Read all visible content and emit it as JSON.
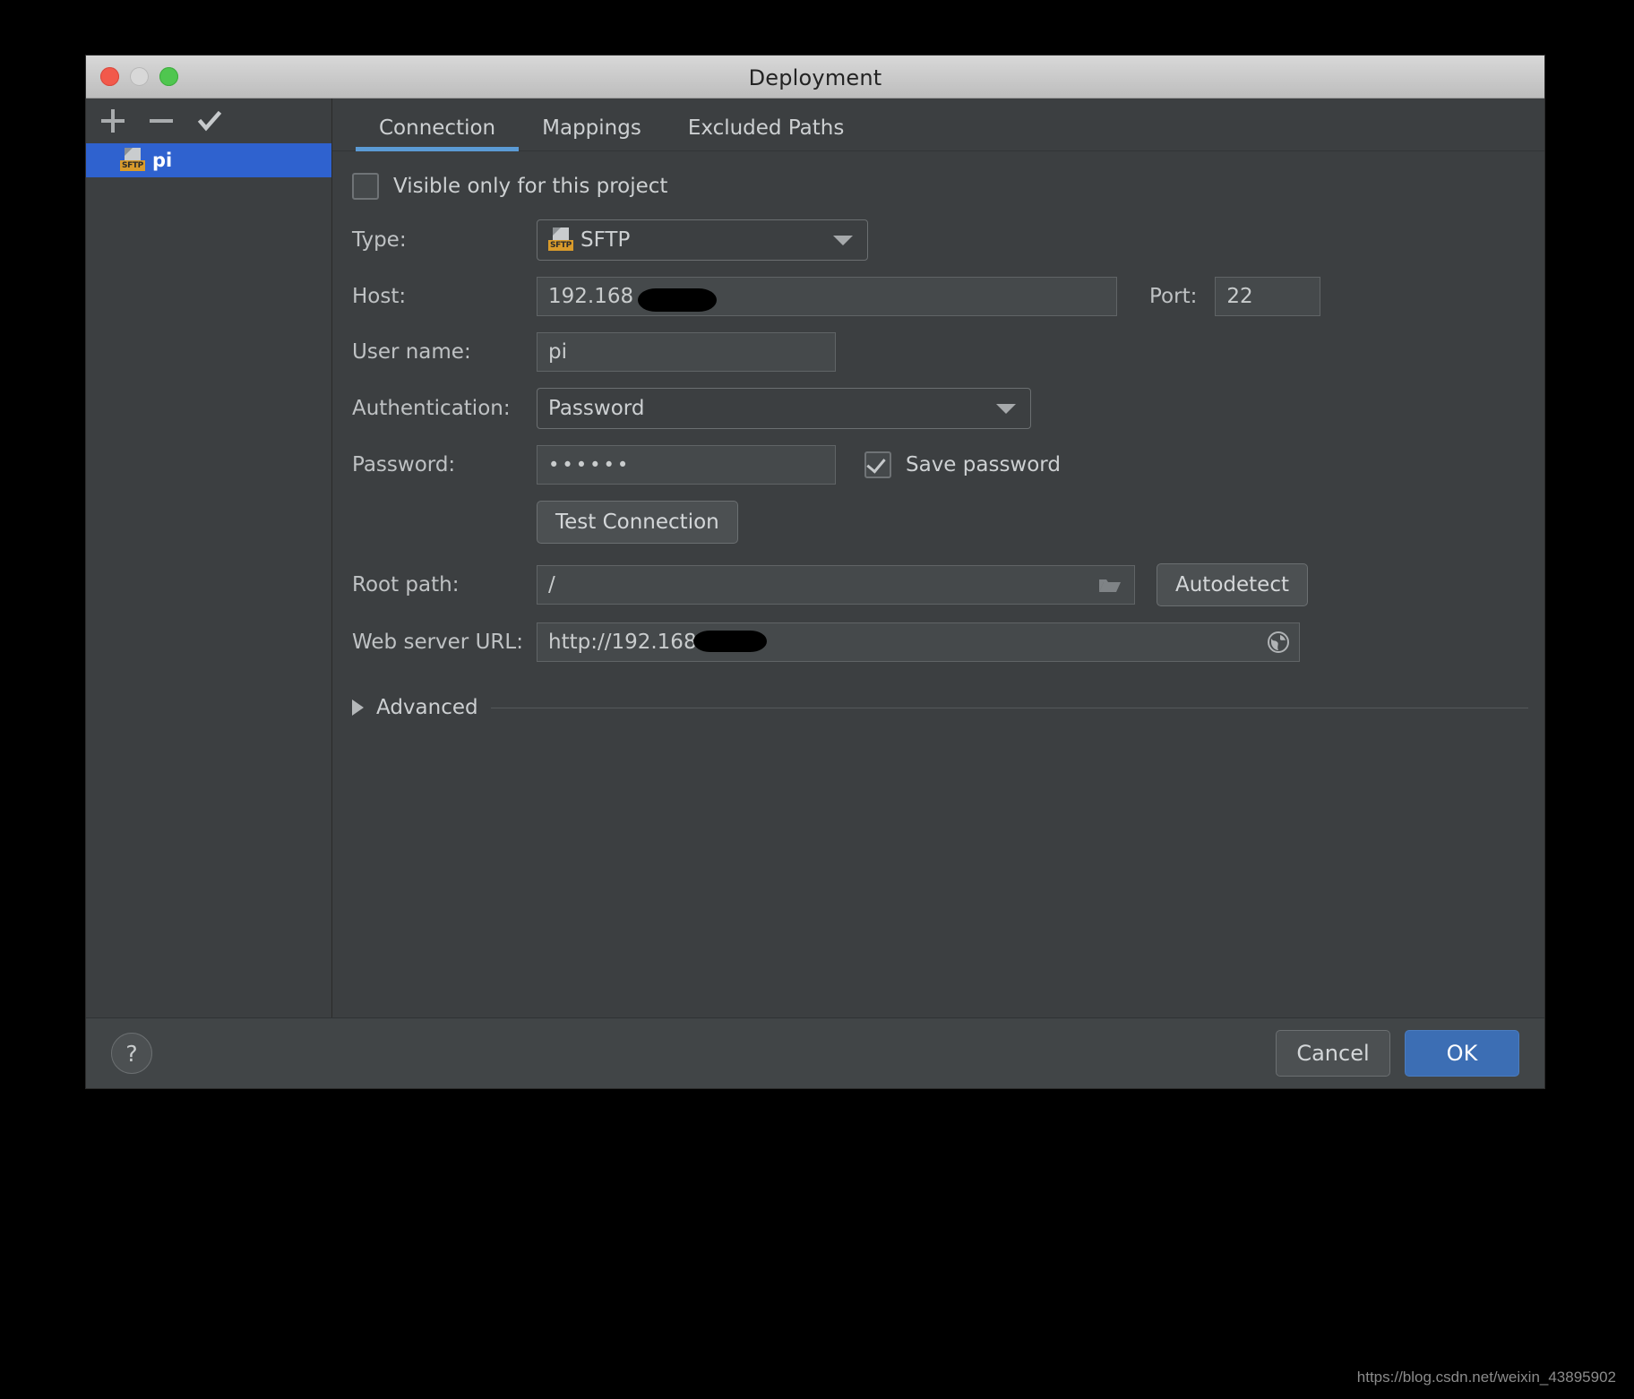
{
  "window": {
    "title": "Deployment",
    "traffic_lights": [
      "close-red",
      "minimize-gray",
      "zoom-green"
    ]
  },
  "sidebar": {
    "toolbar": [
      {
        "name": "add",
        "icon": "plus-icon"
      },
      {
        "name": "remove",
        "icon": "minus-icon"
      },
      {
        "name": "use-as-default",
        "icon": "check-icon"
      }
    ],
    "items": [
      {
        "label": "pi",
        "icon": "sftp-icon",
        "badge": "SFTP",
        "selected": true
      }
    ],
    "selection_color": "#2f62cf"
  },
  "tabs": [
    {
      "label": "Connection",
      "active": true
    },
    {
      "label": "Mappings",
      "active": false
    },
    {
      "label": "Excluded Paths",
      "active": false
    }
  ],
  "form": {
    "visible_only_checkbox": {
      "label": "Visible only for this project",
      "checked": false
    },
    "type": {
      "label": "Type:",
      "value": "SFTP",
      "badge": "SFTP",
      "icon": "chevron-down-icon"
    },
    "host": {
      "label": "Host:",
      "value": "192.168",
      "redacted": true
    },
    "port": {
      "label": "Port:",
      "value": "22"
    },
    "username": {
      "label": "User name:",
      "value": "pi"
    },
    "authentication": {
      "label": "Authentication:",
      "value": "Password",
      "icon": "chevron-down-icon"
    },
    "password": {
      "label": "Password:",
      "value": "••••••"
    },
    "save_password": {
      "label": "Save password",
      "checked": true
    },
    "test_connection": {
      "label": "Test Connection"
    },
    "root_path": {
      "label": "Root path:",
      "value": "/",
      "icon": "folder-icon"
    },
    "autodetect": {
      "label": "Autodetect"
    },
    "web_server_url": {
      "label": "Web server URL:",
      "value": "http://192.168",
      "redacted": true,
      "icon": "globe-icon"
    },
    "advanced": {
      "label": "Advanced",
      "expanded": false,
      "icon": "triangle-right-icon"
    }
  },
  "footer": {
    "help_label": "?",
    "cancel_label": "Cancel",
    "ok_label": "OK",
    "ok_color": "#3c6eb4"
  },
  "watermark": {
    "text": "https://blog.csdn.net/weixin_43895902"
  }
}
